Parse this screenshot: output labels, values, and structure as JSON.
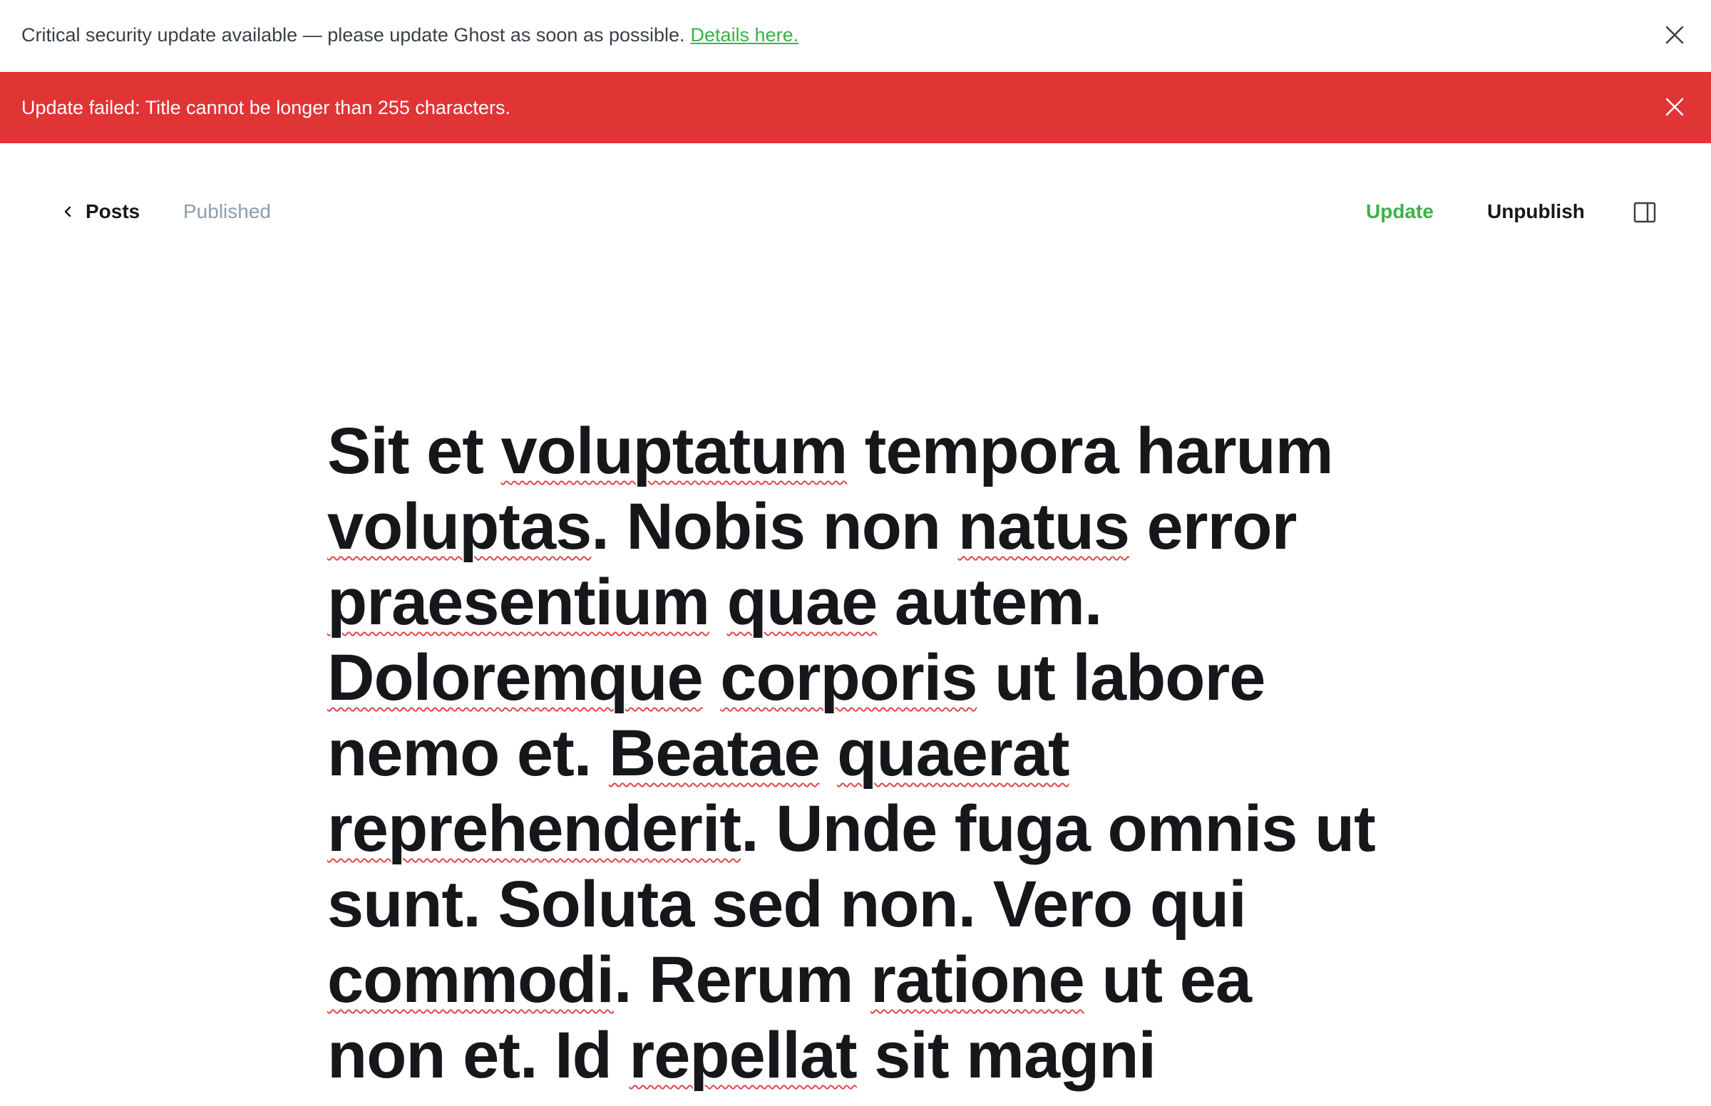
{
  "security_banner": {
    "message": "Critical security update available — please update Ghost as soon as possible.",
    "link_label": "Details here.",
    "close_icon": "close-icon"
  },
  "error_bar": {
    "message": "Update failed: Title cannot be longer than 255 characters.",
    "background": "#e13435",
    "close_icon": "close-icon"
  },
  "toolbar": {
    "back_label": "Posts",
    "back_icon": "chevron-left-icon",
    "status": "Published",
    "update_label": "Update",
    "update_color": "#3eb04a",
    "unpublish_label": "Unpublish",
    "sidebar_icon": "sidebar-panel-icon"
  },
  "editor": {
    "title_segments": [
      {
        "text": "Sit et ",
        "misspelled": false
      },
      {
        "text": "voluptatum",
        "misspelled": true
      },
      {
        "text": " tempora harum ",
        "misspelled": false
      },
      {
        "text": "voluptas",
        "misspelled": true
      },
      {
        "text": ". Nobis non ",
        "misspelled": false
      },
      {
        "text": "natus",
        "misspelled": true
      },
      {
        "text": " error ",
        "misspelled": false
      },
      {
        "text": "praesentium",
        "misspelled": true
      },
      {
        "text": " ",
        "misspelled": false
      },
      {
        "text": "quae",
        "misspelled": true
      },
      {
        "text": " autem. ",
        "misspelled": false
      },
      {
        "text": "Doloremque",
        "misspelled": true
      },
      {
        "text": " ",
        "misspelled": false
      },
      {
        "text": "corporis",
        "misspelled": true
      },
      {
        "text": " ut labore nemo et. ",
        "misspelled": false
      },
      {
        "text": "Beatae",
        "misspelled": true
      },
      {
        "text": " ",
        "misspelled": false
      },
      {
        "text": "quaerat",
        "misspelled": true
      },
      {
        "text": " ",
        "misspelled": false
      },
      {
        "text": "reprehenderit",
        "misspelled": true
      },
      {
        "text": ". Unde fuga omnis ut sunt. Soluta sed non. Vero qui ",
        "misspelled": false
      },
      {
        "text": "commodi",
        "misspelled": true
      },
      {
        "text": ". Rerum ",
        "misspelled": false
      },
      {
        "text": "ratione",
        "misspelled": true
      },
      {
        "text": " ut ea non et. Id ",
        "misspelled": false
      },
      {
        "text": "repellat",
        "misspelled": true
      },
      {
        "text": " sit magni",
        "misspelled": false
      }
    ]
  }
}
